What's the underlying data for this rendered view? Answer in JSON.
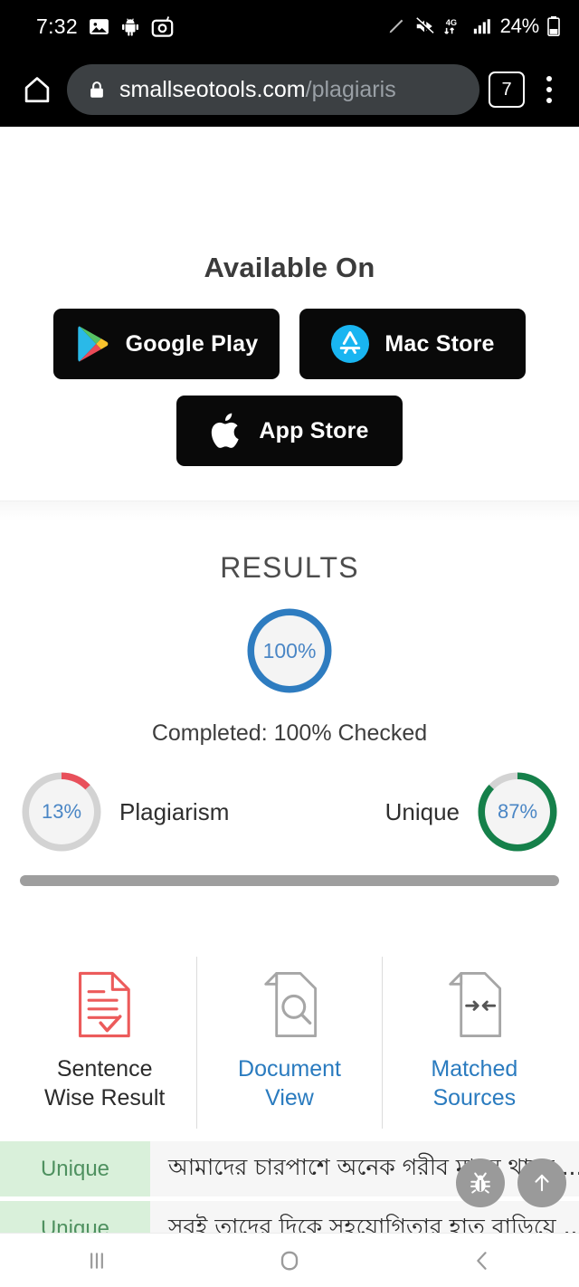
{
  "status_bar": {
    "time": "7:32",
    "battery_percent": "24%",
    "network": "4G",
    "left_icons": [
      "gallery-image-icon",
      "android-robot-icon",
      "screenshot-camera-icon"
    ],
    "right_icons": [
      "stylus-pen-icon",
      "volume-muted-icon",
      "network-4g-icon",
      "signal-bars-icon",
      "battery-icon"
    ]
  },
  "browser": {
    "home_icon": "home-icon",
    "lock_icon": "lock-icon",
    "url_host": "smallseotools.com",
    "url_path": "/plagiaris",
    "tab_count": "7",
    "menu_icon": "kebab-menu-icon"
  },
  "available_on": {
    "heading": "Available On",
    "buttons": [
      {
        "label": "Google Play",
        "icon": "google-play-icon"
      },
      {
        "label": "Mac Store",
        "icon": "mac-app-store-icon"
      },
      {
        "label": "App Store",
        "icon": "apple-logo-icon"
      }
    ]
  },
  "results": {
    "title": "RESULTS",
    "overall_percent": "100%",
    "completed_text": "Completed: 100% Checked",
    "plagiarism": {
      "percent": "13%",
      "label": "Plagiarism",
      "value": 13,
      "color": "#e8505b"
    },
    "unique": {
      "percent": "87%",
      "label": "Unique",
      "value": 87,
      "color": "#15804a"
    },
    "overall_color": "#2e7cc0",
    "track_color": "#d3d3d3"
  },
  "view_tabs": [
    {
      "label_line1": "Sentence",
      "label_line2": "Wise Result",
      "icon": "document-checklist-icon",
      "active": true
    },
    {
      "label_line1": "Document",
      "label_line2": "View",
      "icon": "document-search-icon",
      "active": false
    },
    {
      "label_line1": "Matched",
      "label_line2": "Sources",
      "icon": "document-matched-icon",
      "active": false
    }
  ],
  "sentence_rows": [
    {
      "status": "Unique",
      "text": "আমাদের চারপাশে অনেক গরীব মানুষ থাকে ..."
    },
    {
      "status": "Unique",
      "text": "সবই তাদের দিকে সহযোগিতার হাত বাড়িয়ে ..."
    }
  ],
  "floating_buttons": [
    {
      "icon": "bug-report-icon"
    },
    {
      "icon": "scroll-to-top-arrow-icon"
    }
  ],
  "android_nav": [
    {
      "icon": "recent-apps-icon"
    },
    {
      "icon": "home-circle-icon"
    },
    {
      "icon": "back-chevron-icon"
    }
  ]
}
